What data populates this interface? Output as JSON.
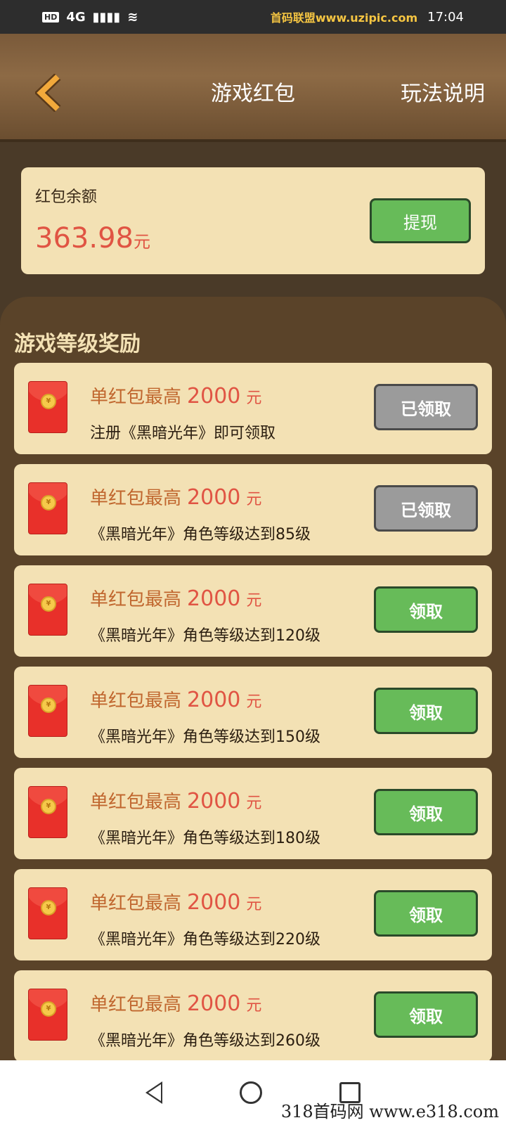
{
  "status_bar": {
    "hd": "HD",
    "signal": "4G",
    "watermark": "首码联盟www.uzipic.com",
    "time": "17:04"
  },
  "header": {
    "title": "游戏红包",
    "rules_label": "玩法说明"
  },
  "balance": {
    "label": "红包余额",
    "amount": "363.98",
    "unit": "元",
    "withdraw_label": "提现"
  },
  "rewards": {
    "section_title": "游戏等级奖励",
    "items": [
      {
        "title": "单红包最高",
        "amount": "2000",
        "unit": "元",
        "desc": "注册《黑暗光年》即可领取",
        "button": "已领取",
        "status": "claimed"
      },
      {
        "title": "单红包最高",
        "amount": "2000",
        "unit": "元",
        "desc": "《黑暗光年》角色等级达到85级",
        "button": "已领取",
        "status": "claimed"
      },
      {
        "title": "单红包最高",
        "amount": "2000",
        "unit": "元",
        "desc": "《黑暗光年》角色等级达到120级",
        "button": "领取",
        "status": "available"
      },
      {
        "title": "单红包最高",
        "amount": "2000",
        "unit": "元",
        "desc": "《黑暗光年》角色等级达到150级",
        "button": "领取",
        "status": "available"
      },
      {
        "title": "单红包最高",
        "amount": "2000",
        "unit": "元",
        "desc": "《黑暗光年》角色等级达到180级",
        "button": "领取",
        "status": "available"
      },
      {
        "title": "单红包最高",
        "amount": "2000",
        "unit": "元",
        "desc": "《黑暗光年》角色等级达到220级",
        "button": "领取",
        "status": "available"
      },
      {
        "title": "单红包最高",
        "amount": "2000",
        "unit": "元",
        "desc": "《黑暗光年》角色等级达到260级",
        "button": "领取",
        "status": "available"
      }
    ]
  },
  "watermark_bottom": "318首码网 www.e318.com",
  "colors": {
    "accent_red": "#e05443",
    "button_green": "#67bb59",
    "button_gray": "#9b9b9b",
    "card_bg": "#f3e1b4"
  }
}
